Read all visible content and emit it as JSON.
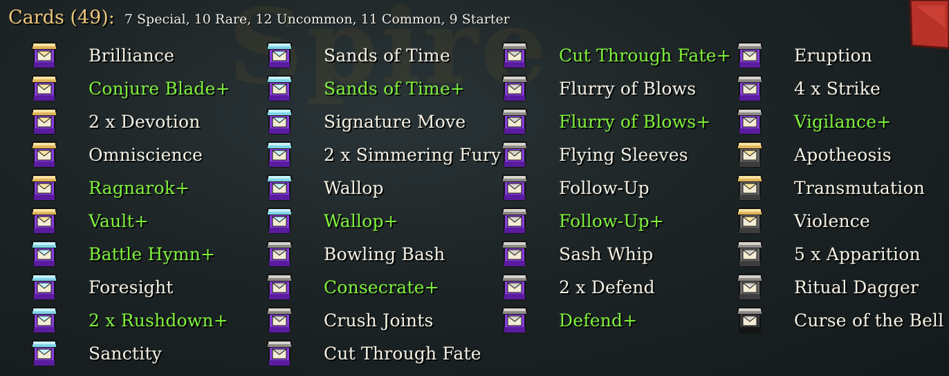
{
  "header": {
    "title": "Cards (49):",
    "summary": "7 Special, 10 Rare, 12 Uncommon, 11 Common, 9 Starter"
  },
  "colors": {
    "title": "#eec87a",
    "upgraded": "#7ff23b",
    "normal": "#f4f1e4",
    "purple_body": "#7a28c8",
    "grey_body": "#5a5a5a"
  },
  "columns": [
    [
      {
        "name": "Brilliance",
        "upgraded": false,
        "lid": "gold",
        "body": "purple",
        "icon": "card-jar-icon"
      },
      {
        "name": "Conjure Blade+",
        "upgraded": true,
        "lid": "gold",
        "body": "purple",
        "icon": "card-jar-icon"
      },
      {
        "name": "2 x Devotion",
        "upgraded": false,
        "lid": "gold",
        "body": "purple",
        "icon": "card-jar-icon"
      },
      {
        "name": "Omniscience",
        "upgraded": false,
        "lid": "gold",
        "body": "purple",
        "icon": "card-jar-icon"
      },
      {
        "name": "Ragnarok+",
        "upgraded": true,
        "lid": "gold",
        "body": "purple",
        "icon": "card-jar-icon"
      },
      {
        "name": "Vault+",
        "upgraded": true,
        "lid": "gold",
        "body": "purple",
        "icon": "card-jar-icon"
      },
      {
        "name": "Battle Hymn+",
        "upgraded": true,
        "lid": "blue",
        "body": "purple",
        "icon": "card-jar-icon"
      },
      {
        "name": "Foresight",
        "upgraded": false,
        "lid": "blue",
        "body": "purple",
        "icon": "card-jar-icon"
      },
      {
        "name": "2 x Rushdown+",
        "upgraded": true,
        "lid": "blue",
        "body": "purple",
        "icon": "card-jar-icon"
      },
      {
        "name": "Sanctity",
        "upgraded": false,
        "lid": "blue",
        "body": "purple",
        "icon": "card-jar-icon"
      }
    ],
    [
      {
        "name": "Sands of Time",
        "upgraded": false,
        "lid": "blue",
        "body": "purple",
        "icon": "card-jar-icon"
      },
      {
        "name": "Sands of Time+",
        "upgraded": true,
        "lid": "blue",
        "body": "purple",
        "icon": "card-jar-icon"
      },
      {
        "name": "Signature Move",
        "upgraded": false,
        "lid": "blue",
        "body": "purple",
        "icon": "card-jar-icon"
      },
      {
        "name": "2 x Simmering Fury",
        "upgraded": false,
        "lid": "blue",
        "body": "purple",
        "icon": "card-jar-icon"
      },
      {
        "name": "Wallop",
        "upgraded": false,
        "lid": "blue",
        "body": "purple",
        "icon": "card-jar-icon"
      },
      {
        "name": "Wallop+",
        "upgraded": true,
        "lid": "blue",
        "body": "purple",
        "icon": "card-jar-icon"
      },
      {
        "name": "Bowling Bash",
        "upgraded": false,
        "lid": "grey",
        "body": "purple",
        "icon": "card-jar-icon"
      },
      {
        "name": "Consecrate+",
        "upgraded": true,
        "lid": "grey",
        "body": "purple",
        "icon": "card-jar-icon"
      },
      {
        "name": "Crush Joints",
        "upgraded": false,
        "lid": "grey",
        "body": "purple",
        "icon": "card-jar-icon"
      },
      {
        "name": "Cut Through Fate",
        "upgraded": false,
        "lid": "grey",
        "body": "purple",
        "icon": "card-jar-icon"
      }
    ],
    [
      {
        "name": "Cut Through Fate+",
        "upgraded": true,
        "lid": "grey",
        "body": "purple",
        "icon": "card-jar-icon"
      },
      {
        "name": "Flurry of Blows",
        "upgraded": false,
        "lid": "grey",
        "body": "purple",
        "icon": "card-jar-icon"
      },
      {
        "name": "Flurry of Blows+",
        "upgraded": true,
        "lid": "grey",
        "body": "purple",
        "icon": "card-jar-icon"
      },
      {
        "name": "Flying Sleeves",
        "upgraded": false,
        "lid": "grey",
        "body": "purple",
        "icon": "card-jar-icon"
      },
      {
        "name": "Follow-Up",
        "upgraded": false,
        "lid": "grey",
        "body": "purple",
        "icon": "card-jar-icon"
      },
      {
        "name": "Follow-Up+",
        "upgraded": true,
        "lid": "grey",
        "body": "purple",
        "icon": "card-jar-icon"
      },
      {
        "name": "Sash Whip",
        "upgraded": false,
        "lid": "grey",
        "body": "purple",
        "icon": "card-jar-icon"
      },
      {
        "name": "2 x Defend",
        "upgraded": false,
        "lid": "grey",
        "body": "purple",
        "icon": "card-jar-icon"
      },
      {
        "name": "Defend+",
        "upgraded": true,
        "lid": "grey",
        "body": "purple",
        "icon": "card-jar-icon"
      }
    ],
    [
      {
        "name": "Eruption",
        "upgraded": false,
        "lid": "grey",
        "body": "purple",
        "icon": "card-jar-icon"
      },
      {
        "name": "4 x Strike",
        "upgraded": false,
        "lid": "grey",
        "body": "purple",
        "icon": "card-jar-icon"
      },
      {
        "name": "Vigilance+",
        "upgraded": true,
        "lid": "grey",
        "body": "purple",
        "icon": "card-jar-icon"
      },
      {
        "name": "Apotheosis",
        "upgraded": false,
        "lid": "gold",
        "body": "grey",
        "icon": "card-jar-icon"
      },
      {
        "name": "Transmutation",
        "upgraded": false,
        "lid": "gold",
        "body": "grey",
        "icon": "card-jar-icon"
      },
      {
        "name": "Violence",
        "upgraded": false,
        "lid": "gold",
        "body": "grey",
        "icon": "card-jar-icon"
      },
      {
        "name": "5 x Apparition",
        "upgraded": false,
        "lid": "grey",
        "body": "grey",
        "icon": "card-jar-icon"
      },
      {
        "name": "Ritual Dagger",
        "upgraded": false,
        "lid": "grey",
        "body": "grey",
        "icon": "card-jar-icon"
      },
      {
        "name": "Curse of the Bell",
        "upgraded": false,
        "lid": "grey",
        "body": "black",
        "icon": "card-jar-icon"
      }
    ]
  ],
  "back_button": {
    "icon": "back-arrow-icon"
  }
}
